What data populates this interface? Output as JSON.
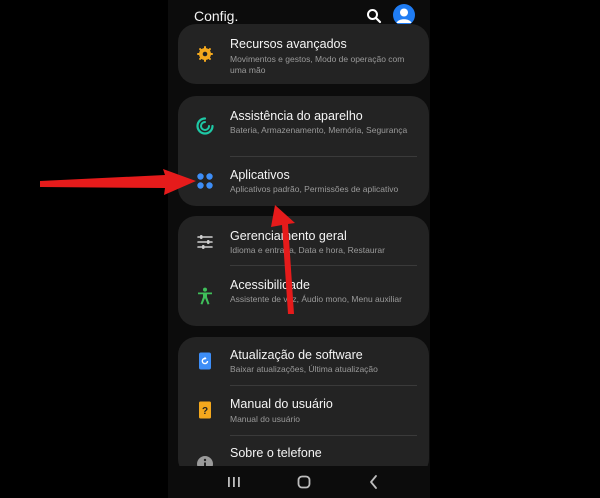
{
  "header": {
    "title": "Config."
  },
  "cards": [
    {
      "items": [
        {
          "title": "Recursos avançados",
          "subtitle": "Movimentos e gestos, Modo de operação com uma mão",
          "icon": "gear-plus-icon"
        }
      ]
    },
    {
      "items": [
        {
          "title": "Assistência do aparelho",
          "subtitle": "Bateria, Armazenamento, Memória, Segurança",
          "icon": "device-care-icon"
        },
        {
          "title": "Aplicativos",
          "subtitle": "Aplicativos padrão, Permissões de aplicativo",
          "icon": "apps-grid-icon"
        }
      ]
    },
    {
      "items": [
        {
          "title": "Gerenciamento geral",
          "subtitle": "Idioma e entrada, Data e hora, Restaurar",
          "icon": "sliders-icon"
        },
        {
          "title": "Acessibilidade",
          "subtitle": "Assistente de voz, Áudio mono, Menu auxiliar",
          "icon": "accessibility-icon"
        }
      ]
    },
    {
      "items": [
        {
          "title": "Atualização de software",
          "subtitle": "Baixar atualizações, Última atualização",
          "icon": "software-update-icon"
        },
        {
          "title": "Manual do usuário",
          "subtitle": "Manual do usuário",
          "icon": "manual-icon"
        },
        {
          "title": "Sobre o telefone",
          "subtitle": "",
          "icon": "info-icon"
        }
      ]
    }
  ],
  "colors": {
    "accent_blue": "#3d8ef8",
    "teal": "#1ec8a5",
    "amber": "#f4a81d",
    "green": "#3fbf5a",
    "annotation_red": "#e61b1b"
  }
}
